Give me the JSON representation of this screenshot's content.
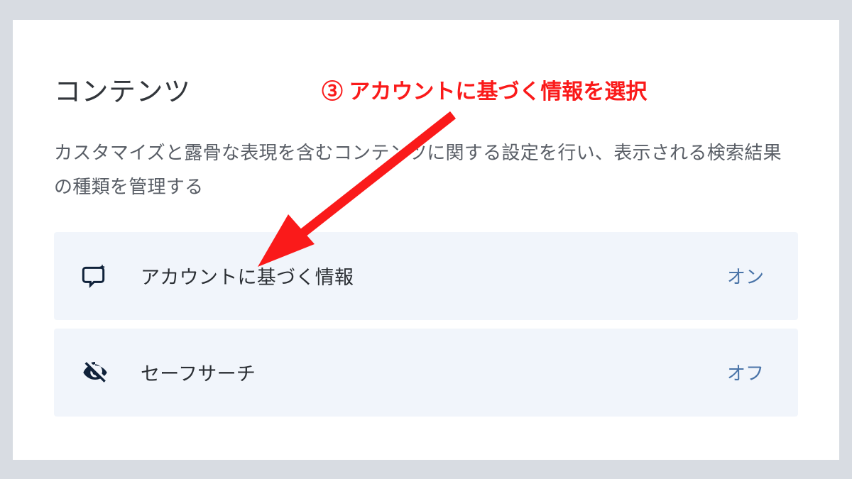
{
  "title": "コンテンツ",
  "description": "カスタマイズと露骨な表現を含むコンテンツに関する設定を行い、表示される検索結果の種類を管理する",
  "annotation": {
    "text": "③ アカウントに基づく情報を選択",
    "color": "#fa1a1a"
  },
  "settings": [
    {
      "icon": "chat-sparkle-icon",
      "label": "アカウントに基づく情報",
      "status": "オン"
    },
    {
      "icon": "eye-off-icon",
      "label": "セーフサーチ",
      "status": "オフ"
    }
  ]
}
